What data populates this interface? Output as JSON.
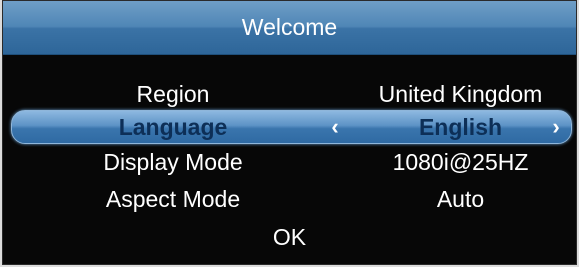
{
  "dialog": {
    "title": "Welcome"
  },
  "settings": [
    {
      "label": "Region",
      "value": "United Kingdom"
    },
    {
      "label": "Language",
      "value": "English",
      "selected": true,
      "arrow_left": "‹",
      "arrow_right": "›"
    },
    {
      "label": "Display Mode",
      "value": "1080i@25HZ"
    },
    {
      "label": "Aspect Mode",
      "value": "Auto"
    }
  ],
  "ok_label": "OK",
  "colors": {
    "title_bar": "#4f86b6",
    "highlight": "#5d93c6",
    "background": "#070707",
    "text": "#ffffff",
    "selected_text": "#0d2f57"
  }
}
